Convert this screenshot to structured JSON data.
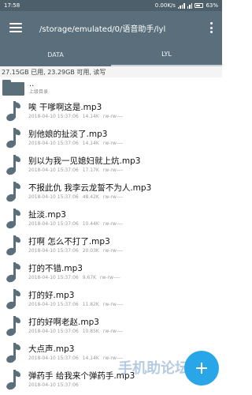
{
  "status_bar": {
    "time": "17:58",
    "net_speed": "0.00K/s",
    "battery": "63%"
  },
  "toolbar": {
    "path": "/storage/emulated/0/语音助手/lyl",
    "menu_icon": "hamburger-menu-icon",
    "overflow_icon": "more-vert-icon"
  },
  "tabs": [
    {
      "label": "DATA",
      "active": false
    },
    {
      "label": "LYL",
      "active": true
    }
  ],
  "storage_info": "27.15GB 已用, 23.29GB 可用, 读写",
  "parent": {
    "name": "..",
    "subtitle": "上级目录"
  },
  "files": [
    {
      "name": "唉 干嗲啊这是.mp3",
      "date": "2018-04-10 15:37:06",
      "size": "14.14K",
      "perm": "rw-rw----"
    },
    {
      "name": "别他娘的扯淡了.mp3",
      "date": "2018-04-10 15:37:06",
      "size": "14.14K",
      "perm": "rw-rw----"
    },
    {
      "name": "别以为我一见媳妇就上炕.mp3",
      "date": "2018-04-10 15:37:06",
      "size": "17.17K",
      "perm": "rw-rw----"
    },
    {
      "name": "不报此仇 我李云龙誓不为人.mp3",
      "date": "2018-04-10 15:37:06",
      "size": "48.42K",
      "perm": "rw-rw----"
    },
    {
      "name": "扯淡.mp3",
      "date": "2018-04-10 15:37:06",
      "size": "10.44K",
      "perm": "rw-rw----"
    },
    {
      "name": "打啊 怎么不打了.mp3",
      "date": "2018-04-10 15:37:06",
      "size": "20.03K",
      "perm": "rw-rw----"
    },
    {
      "name": "打的不错.mp3",
      "date": "2018-04-10 15:37:06",
      "size": "9.67K",
      "perm": "rw-rw----"
    },
    {
      "name": "打的好.mp3",
      "date": "2018-04-10 15:37:06",
      "size": "11.82K",
      "perm": "rw-rw----"
    },
    {
      "name": "打的好啊老赵.mp3",
      "date": "2018-04-10 15:37:06",
      "size": "10.85K",
      "perm": "rw-rw----"
    },
    {
      "name": "大点声.mp3",
      "date": "2018-04-10 15:37:06",
      "size": "14.14K",
      "perm": "rw-rw----"
    },
    {
      "name": "弹药手 给我来个弹药手.mp3",
      "date": "2018-04-10 15:37:06",
      "size": "",
      "perm": ""
    }
  ],
  "fab_icon": "add-icon",
  "watermark": "手机助论坛",
  "colors": {
    "toolbar": "#5a6f7b",
    "status_bar": "#4c5f6b",
    "fab": "#29a6e8",
    "icon": "#5b6f7b"
  }
}
